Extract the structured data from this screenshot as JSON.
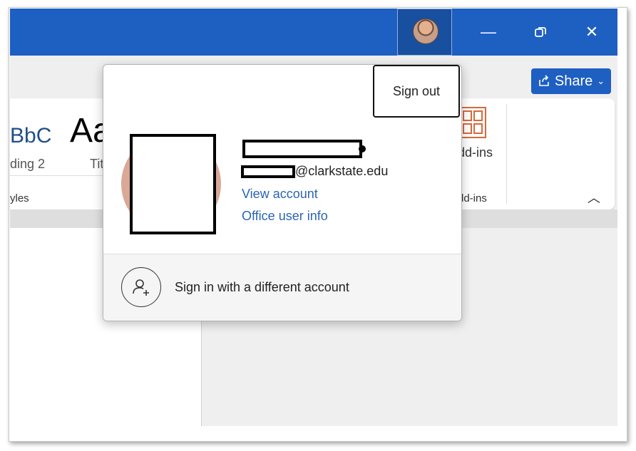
{
  "window": {
    "minimize_icon": "minimize-icon",
    "restore_icon": "restore-icon",
    "close_icon": "close-icon",
    "colors": {
      "titlebar": "#1e5fc2",
      "link": "#2b64b5"
    }
  },
  "ribbon": {
    "share_label": "Share",
    "styles_sample_1": "BbC",
    "styles_sample_2": "Aa",
    "heading_label": "ding 2",
    "title_label": "Tit",
    "styles_group_label": "yles",
    "addins_label": "dd-ins",
    "addins_group_label": "dd-ins"
  },
  "account_popup": {
    "sign_out_label": "Sign out",
    "email_domain": "@clarkstate.edu",
    "view_account_label": "View account",
    "office_user_info_label": "Office user info",
    "different_account_label": "Sign in with a different account"
  }
}
